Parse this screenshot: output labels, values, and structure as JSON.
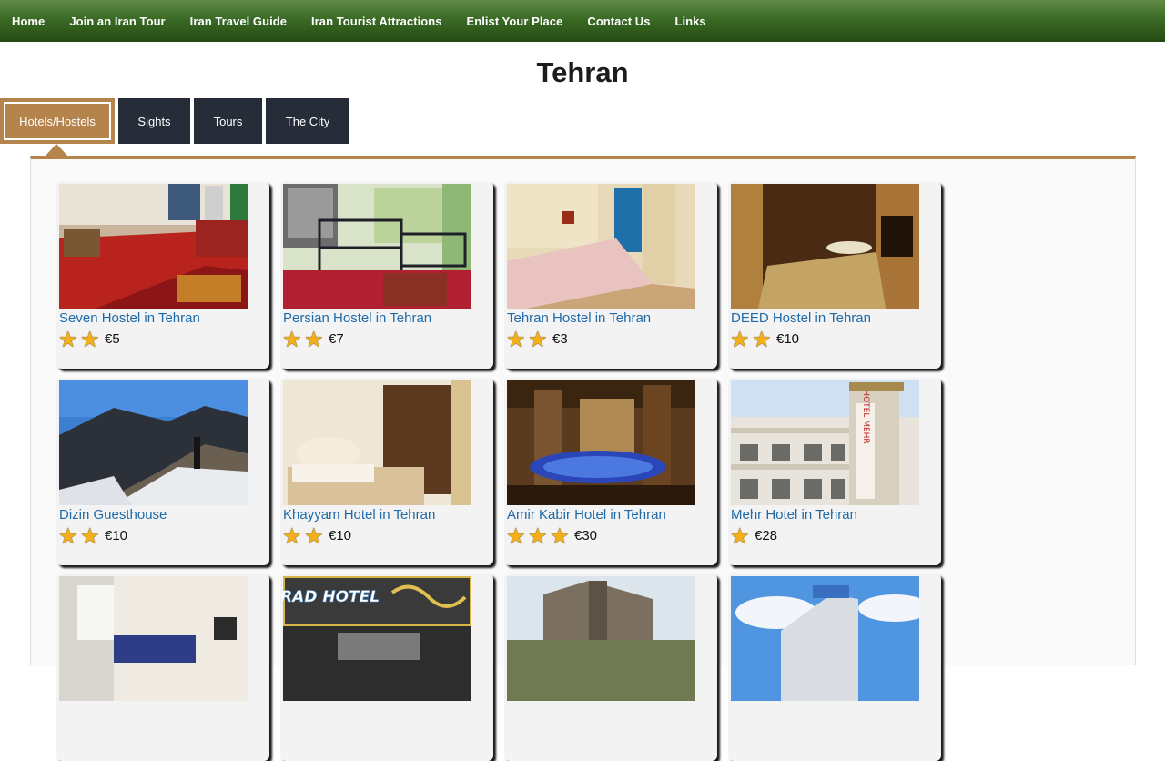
{
  "nav": [
    "Home",
    "Join an Iran Tour",
    "Iran Travel Guide",
    "Iran Tourist Attractions",
    "Enlist Your Place",
    "Contact Us",
    "Links"
  ],
  "page_title": "Tehran",
  "tabs": [
    {
      "label": "Hotels/Hostels",
      "active": true
    },
    {
      "label": "Sights",
      "active": false
    },
    {
      "label": "Tours",
      "active": false
    },
    {
      "label": "The City",
      "active": false
    }
  ],
  "colors": {
    "nav_green": "#3b6b26",
    "tab_dark": "#262d38",
    "accent_brown": "#b5844d",
    "link_blue": "#1f6aa8",
    "star_gold": "#f3b01a"
  },
  "listings": [
    {
      "name": "Seven Hostel in Tehran",
      "stars": 2,
      "price": "€5"
    },
    {
      "name": "Persian Hostel in Tehran",
      "stars": 2,
      "price": "€7"
    },
    {
      "name": "Tehran Hostel in Tehran",
      "stars": 2,
      "price": "€3"
    },
    {
      "name": "DEED Hostel in Tehran",
      "stars": 2,
      "price": "€10"
    },
    {
      "name": "Dizin Guesthouse",
      "stars": 2,
      "price": "€10"
    },
    {
      "name": "Khayyam Hotel in Tehran",
      "stars": 2,
      "price": "€10"
    },
    {
      "name": "Amir Kabir Hotel in Tehran",
      "stars": 3,
      "price": "€30"
    },
    {
      "name": "Mehr Hotel in Tehran",
      "stars": 1,
      "price": "€28"
    },
    {
      "name": "",
      "stars": 0,
      "price": ""
    },
    {
      "name": "",
      "stars": 0,
      "price": ""
    },
    {
      "name": "",
      "stars": 0,
      "price": ""
    },
    {
      "name": "",
      "stars": 0,
      "price": ""
    }
  ],
  "photo_signs": {
    "arad_hotel": "ARAD HOTEL",
    "mehr_vertical": "HOTEL MEHR"
  }
}
